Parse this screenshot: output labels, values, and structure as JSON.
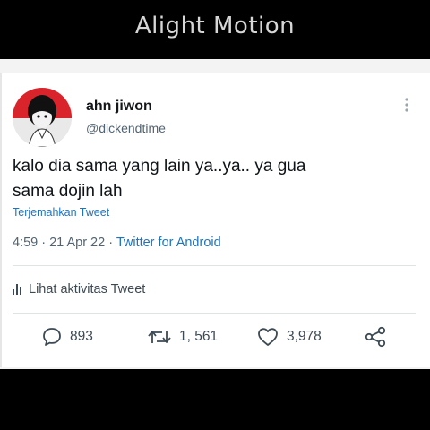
{
  "watermark": "Alight Motion",
  "tweet": {
    "display_name": "ahn jiwon",
    "handle": "@dickendtime",
    "more_icon": "more-vertical-icon",
    "text_line1": "kalo dia sama yang lain ya..ya.. ya gua",
    "text_line2": "sama dojin lah",
    "translate": "Terjemahkan Tweet",
    "timestamp": "4:59 · 21 Apr 22 · ",
    "source": "Twitter for Android",
    "activity": "Lihat aktivitas Tweet",
    "replies": "893",
    "retweets": "1, 561",
    "likes": "3,978"
  },
  "icons": {
    "reply": "reply-icon",
    "retweet": "retweet-icon",
    "like": "heart-icon",
    "share": "share-icon",
    "activity": "bar-chart-icon"
  },
  "colors": {
    "link": "#1d74bf",
    "text": "#0f1419",
    "secondary": "#536471"
  }
}
